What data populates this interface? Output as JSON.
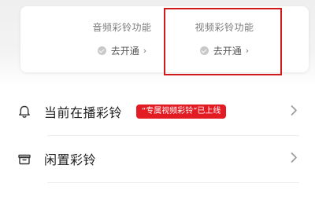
{
  "features": {
    "audio": {
      "title": "音频彩铃功能",
      "action": "去开通"
    },
    "video": {
      "title": "视频彩铃功能",
      "action": "去开通"
    }
  },
  "rows": {
    "current": {
      "label": "当前在播彩铃",
      "badge": "“专属视频彩铃”已上线"
    },
    "idle": {
      "label": "闲置彩铃"
    }
  },
  "colors": {
    "accent": "#e31b23",
    "highlight_border": "#d11a1a"
  },
  "icons": {
    "feature_status": "check-circle-icon",
    "feature_link": "chevron-right-icon",
    "current_row": "bell-icon",
    "idle_row": "storage-box-icon",
    "row_nav": "chevron-right-icon"
  }
}
